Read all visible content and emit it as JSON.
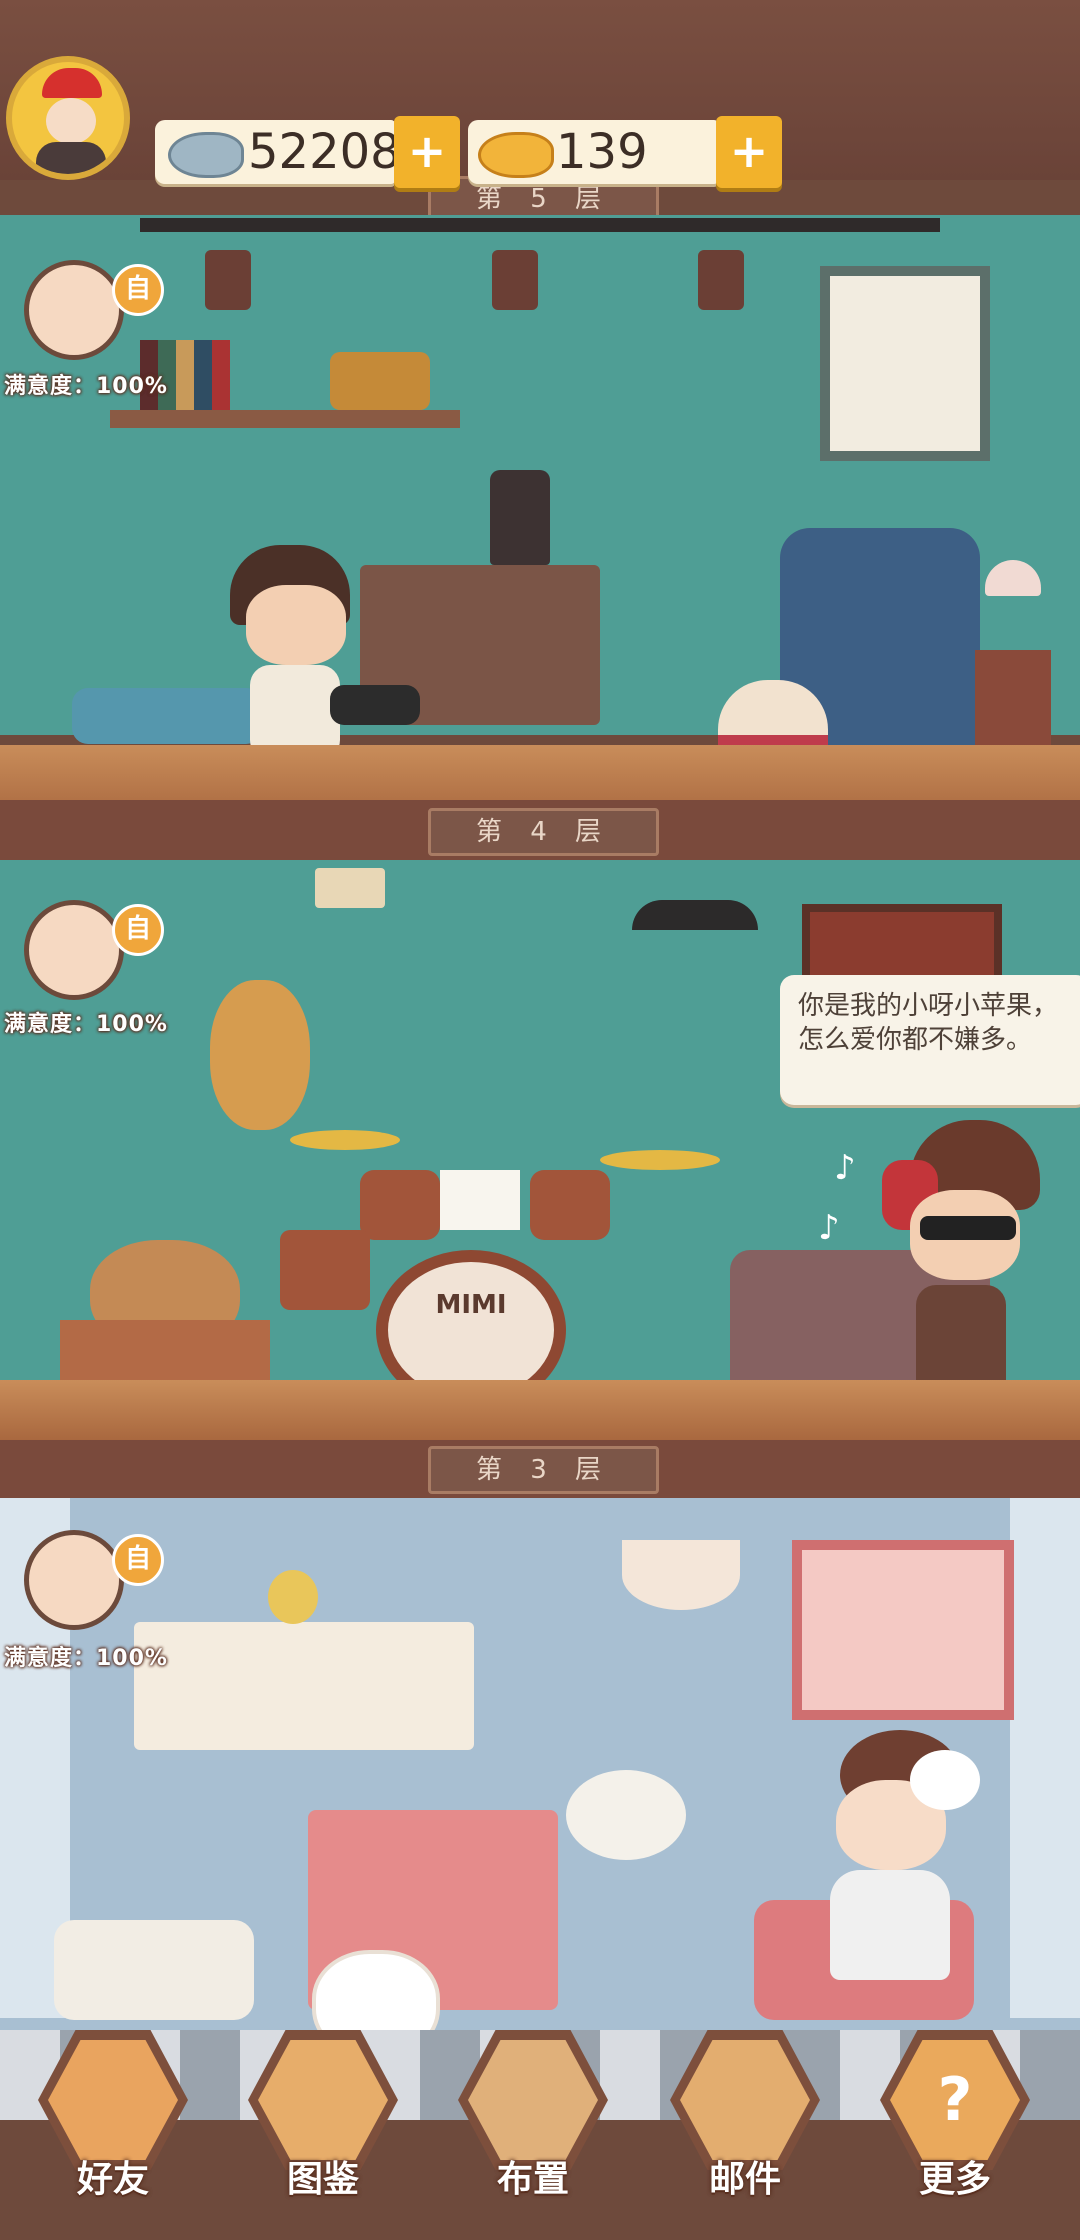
{
  "resources": {
    "fish_silver": "52208",
    "fish_gold": "139"
  },
  "floors": [
    {
      "label": "第 5 层"
    },
    {
      "label": "第 4 层",
      "satisfaction": "满意度：100%"
    },
    {
      "label": "第 3 层",
      "satisfaction": "满意度：100%"
    },
    {
      "satisfaction": "满意度：100%"
    }
  ],
  "speech": {
    "line1": "你是我的小呀小苹果，",
    "line2": "怎么爱你都不嫌多。"
  },
  "drum_text": "MIMI",
  "note_icon_glyph": "自",
  "nav": [
    {
      "label": "好友",
      "icon": "friends-icon"
    },
    {
      "label": "图鉴",
      "icon": "catalog-icon"
    },
    {
      "label": "布置",
      "icon": "decorate-icon"
    },
    {
      "label": "邮件",
      "icon": "mail-icon"
    },
    {
      "label": "更多",
      "icon": "more-icon"
    }
  ],
  "colors": {
    "wall_teal": "#4f9e95",
    "wall_blue": "#a8bfd2",
    "accent_orange": "#f2b22b"
  }
}
